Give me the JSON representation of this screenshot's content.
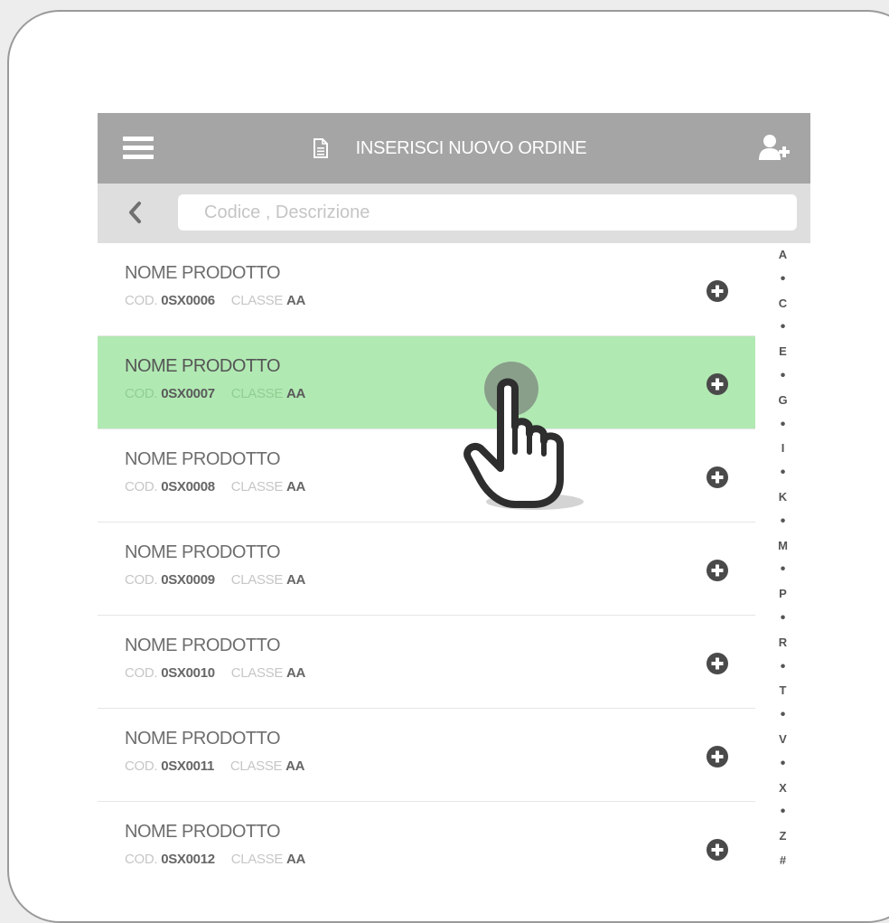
{
  "header": {
    "title": "INSERISCI NUOVO ORDINE",
    "menu_icon": "hamburger-menu-icon",
    "title_icon": "document-icon",
    "action_icon": "add-user-icon"
  },
  "search": {
    "placeholder": "Codice , Descrizione",
    "value": ""
  },
  "products": [
    {
      "name": "NOME PRODOTTO",
      "code_label": "COD.",
      "code": "0SX0006",
      "class_label": "CLASSE",
      "class": "AA"
    },
    {
      "name": "NOME PRODOTTO",
      "code_label": "COD.",
      "code": "0SX0007",
      "class_label": "CLASSE",
      "class": "AA"
    },
    {
      "name": "NOME PRODOTTO",
      "code_label": "COD.",
      "code": "0SX0008",
      "class_label": "CLASSE",
      "class": "AA"
    },
    {
      "name": "NOME PRODOTTO",
      "code_label": "COD.",
      "code": "0SX0009",
      "class_label": "CLASSE",
      "class": "AA"
    },
    {
      "name": "NOME PRODOTTO",
      "code_label": "COD.",
      "code": "0SX0010",
      "class_label": "CLASSE",
      "class": "AA"
    },
    {
      "name": "NOME PRODOTTO",
      "code_label": "COD.",
      "code": "0SX0011",
      "class_label": "CLASSE",
      "class": "AA"
    },
    {
      "name": "NOME PRODOTTO",
      "code_label": "COD.",
      "code": "0SX0012",
      "class_label": "CLASSE",
      "class": "AA"
    }
  ],
  "alpha_index": [
    "A",
    "•",
    "C",
    "•",
    "E",
    "•",
    "G",
    "•",
    "I",
    "•",
    "K",
    "•",
    "M",
    "•",
    "P",
    "•",
    "R",
    "•",
    "T",
    "•",
    "V",
    "•",
    "X",
    "•",
    "Z",
    "#"
  ],
  "colors": {
    "header_bg": "#a5a5a5",
    "search_bar_bg": "#dedede",
    "selected_row": "#b1e9b3",
    "icon_dark": "#4a4a4a"
  }
}
